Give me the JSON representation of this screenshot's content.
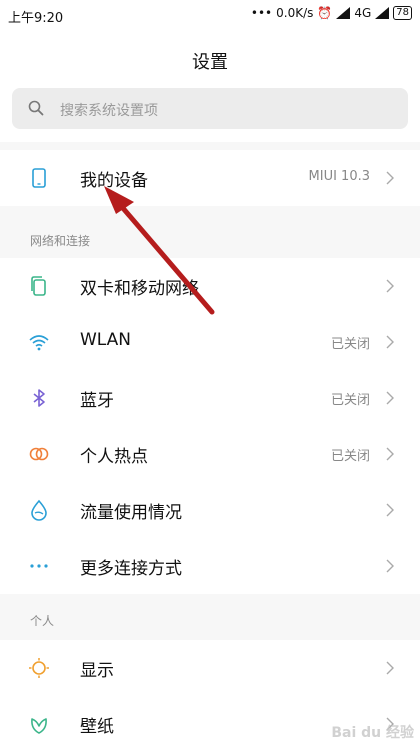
{
  "status_bar": {
    "time": "上午9:20",
    "speed": "0.0K/s",
    "network": "4G",
    "battery": "78"
  },
  "header": {
    "title": "设置"
  },
  "search": {
    "placeholder": "搜索系统设置项"
  },
  "device": {
    "label": "我的设备",
    "value": "MIUI 10.3",
    "icon": "phone-icon"
  },
  "sections": [
    {
      "title": "网络和连接",
      "items": [
        {
          "label": "双卡和移动网络",
          "value": "",
          "icon": "sim-icon",
          "color": "#3bb58a"
        },
        {
          "label": "WLAN",
          "value": "已关闭",
          "icon": "wifi-icon",
          "color": "#2a9fd6"
        },
        {
          "label": "蓝牙",
          "value": "已关闭",
          "icon": "bluetooth-icon",
          "color": "#7a63d4"
        },
        {
          "label": "个人热点",
          "value": "已关闭",
          "icon": "hotspot-icon",
          "color": "#f0803a"
        },
        {
          "label": "流量使用情况",
          "value": "",
          "icon": "data-usage-icon",
          "color": "#2a9fd6"
        },
        {
          "label": "更多连接方式",
          "value": "",
          "icon": "more-icon",
          "color": "#2a9fd6"
        }
      ]
    },
    {
      "title": "个人",
      "items": [
        {
          "label": "显示",
          "value": "",
          "icon": "display-icon",
          "color": "#f0a030"
        },
        {
          "label": "壁纸",
          "value": "",
          "icon": "wallpaper-icon",
          "color": "#3bb58a"
        }
      ]
    }
  ],
  "watermark": "Bai du 经验"
}
